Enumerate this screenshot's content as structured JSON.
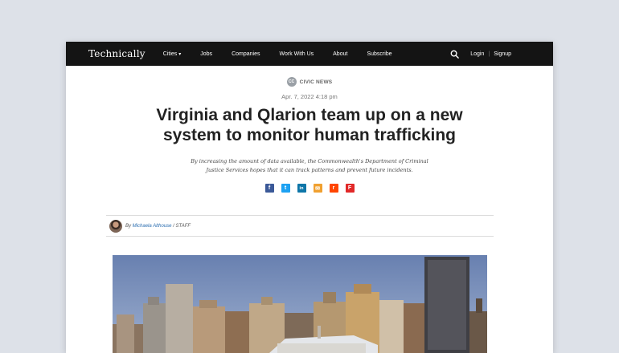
{
  "nav": {
    "logo": "Technically",
    "items": [
      "Cities",
      "Jobs",
      "Companies",
      "Work With Us",
      "About",
      "Subscribe"
    ],
    "login": "Login",
    "separator": "|",
    "signup": "Signup",
    "icons": [
      "search-icon",
      "chevron-down-icon"
    ]
  },
  "article": {
    "category_badge": "CC",
    "category": "CIVIC NEWS",
    "date": "Apr. 7, 2022 4:18 pm",
    "title": "Virginia and Qlarion team up on a new system to monitor human trafficking",
    "subtitle": "By increasing the amount of data available, the Commonwealth's Department of Criminal Justice Services hopes that it can track patterns and prevent future incidents.",
    "share": [
      {
        "name": "facebook-icon",
        "glyph": "f",
        "color": "#3b5998"
      },
      {
        "name": "twitter-icon",
        "glyph": "t",
        "color": "#1da1f2"
      },
      {
        "name": "linkedin-icon",
        "glyph": "in",
        "color": "#0e76a8"
      },
      {
        "name": "email-icon",
        "glyph": "✉",
        "color": "#f0a030"
      },
      {
        "name": "reddit-icon",
        "glyph": "r",
        "color": "#ff4500"
      },
      {
        "name": "flipboard-icon",
        "glyph": "F",
        "color": "#e12828"
      }
    ],
    "byline": {
      "by": "By",
      "author": "Michaela Althouse",
      "role": "/ STAFF"
    }
  },
  "colors": {
    "page_bg": "#dde1e8",
    "nav_bg": "#141414",
    "link": "#2a6db0",
    "sky": "#6f86b4"
  }
}
